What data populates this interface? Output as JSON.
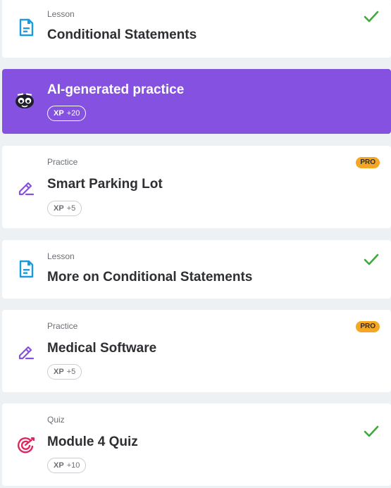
{
  "items": [
    {
      "type": "Lesson",
      "title": "Conditional Statements",
      "icon": "lesson-doc-icon",
      "completed": true
    },
    {
      "type": "",
      "title": "AI-generated practice",
      "icon": "ai-mascot-icon",
      "xp_label": "XP",
      "xp_value": "+20"
    },
    {
      "type": "Practice",
      "title": "Smart Parking Lot",
      "icon": "edit-pencil-icon",
      "badge": "PRO",
      "xp_label": "XP",
      "xp_value": "+5"
    },
    {
      "type": "Lesson",
      "title": "More on Conditional Statements",
      "icon": "lesson-doc-icon",
      "completed": true
    },
    {
      "type": "Practice",
      "title": "Medical Software",
      "icon": "edit-pencil-icon",
      "badge": "PRO",
      "xp_label": "XP",
      "xp_value": "+5"
    },
    {
      "type": "Quiz",
      "title": "Module 4 Quiz",
      "icon": "target-icon",
      "completed": true,
      "xp_label": "XP",
      "xp_value": "+10"
    }
  ],
  "colors": {
    "ai_card": "#8451e0",
    "check": "#3fa93b",
    "pro_badge": "#f5a623",
    "lesson_icon": "#1a9be0",
    "practice_icon": "#8451e0",
    "quiz_icon": "#e0245e"
  }
}
